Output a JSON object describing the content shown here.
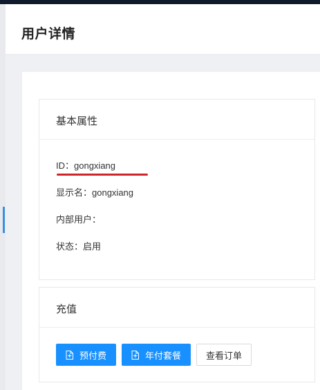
{
  "header": {
    "title": "用户详情"
  },
  "basic_card": {
    "title": "基本属性",
    "fields": [
      {
        "label": "ID：",
        "value": "gongxiang"
      },
      {
        "label": "显示名：",
        "value": "gongxiang"
      },
      {
        "label": "内部用户：",
        "value": ""
      },
      {
        "label": "状态：",
        "value": "启用"
      }
    ],
    "annotation_color": "#d0242b"
  },
  "recharge_card": {
    "title": "充值",
    "buttons": [
      {
        "label": "预付费",
        "icon": "document-icon",
        "style": "primary"
      },
      {
        "label": "年付套餐",
        "icon": "document-icon",
        "style": "primary"
      },
      {
        "label": "查看订单",
        "style": "default"
      }
    ]
  },
  "colors": {
    "primary": "#1890ff",
    "topbar": "#0f1b2d",
    "page_bg": "#eef0f4"
  }
}
